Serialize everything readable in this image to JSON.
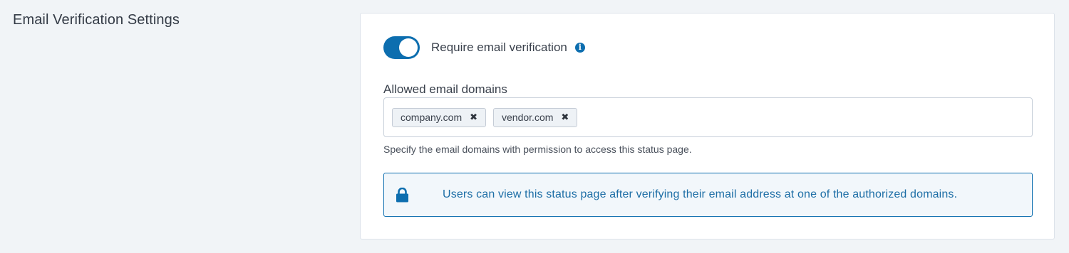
{
  "section": {
    "title": "Email Verification Settings"
  },
  "verification": {
    "toggle_on": true,
    "toggle_label": "Require email verification",
    "info_icon": "info-icon"
  },
  "domains": {
    "label": "Allowed email domains",
    "tags": [
      {
        "label": "company.com",
        "remove_icon": "close-icon"
      },
      {
        "label": "vendor.com",
        "remove_icon": "close-icon"
      }
    ],
    "help_text": "Specify the email domains with permission to access this status page."
  },
  "notice": {
    "icon": "lock-icon",
    "text": "Users can view this status page after verifying their email address at one of the authorized domains."
  },
  "colors": {
    "accent": "#0d6eaf",
    "background": "#f1f4f7",
    "notice_text": "#1d6ea6"
  }
}
